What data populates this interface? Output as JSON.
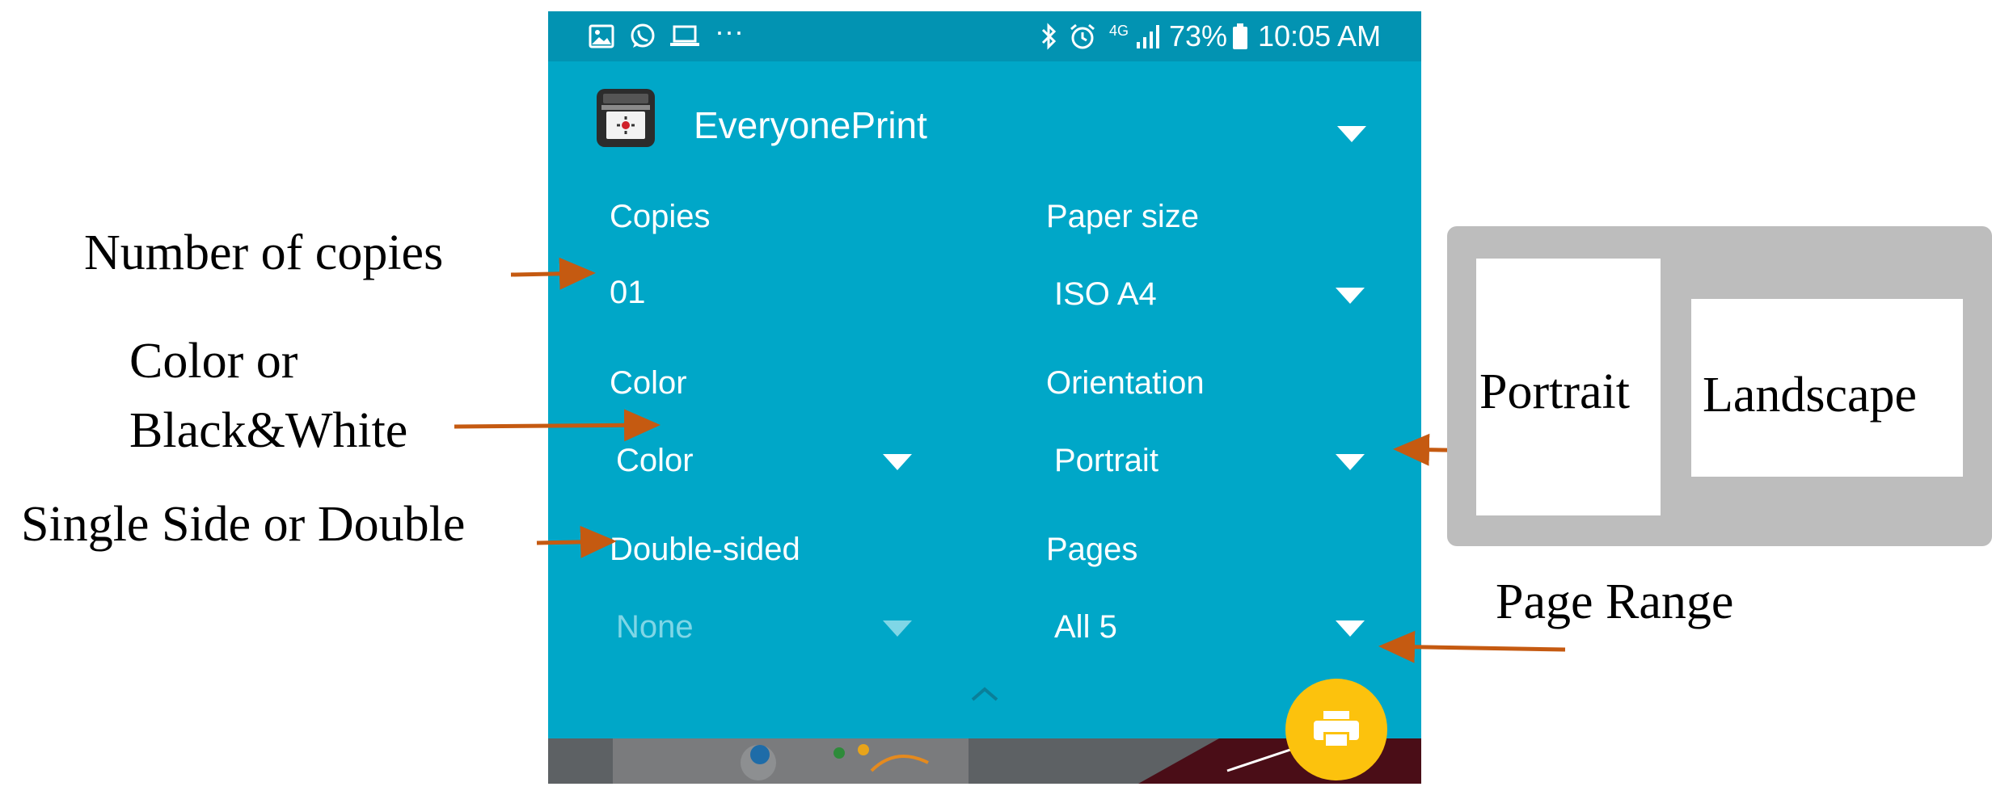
{
  "status_bar": {
    "battery_percent": "73%",
    "time": "10:05 AM",
    "network": "4G",
    "more_icons": "···",
    "icons": [
      "gallery-icon",
      "whatsapp-icon",
      "laptop-icon",
      "bluetooth-icon",
      "alarm-icon",
      "signal-icon",
      "battery-icon"
    ]
  },
  "printer": {
    "name": "EveryonePrint",
    "icon": "printer-app-icon"
  },
  "fields": {
    "copies": {
      "label": "Copies",
      "value": "01"
    },
    "paper_size": {
      "label": "Paper size",
      "value": "ISO A4"
    },
    "color": {
      "label": "Color",
      "value": "Color"
    },
    "orientation": {
      "label": "Orientation",
      "value": "Portrait"
    },
    "double_sided": {
      "label": "Double-sided",
      "value": "None"
    },
    "pages": {
      "label": "Pages",
      "value": "All 5"
    }
  },
  "annotations": {
    "copies": "Number of copies",
    "color_line1": "Color or",
    "color_line2": "Black&White",
    "double_sided": "Single Side or Double",
    "page_range": "Page Range"
  },
  "orientation_options": {
    "portrait": "Portrait",
    "landscape": "Landscape"
  },
  "colors": {
    "accent": "#00a7c8",
    "status_bar": "#0293b2",
    "fab": "#fcc20d",
    "arrow": "#c55a11"
  }
}
